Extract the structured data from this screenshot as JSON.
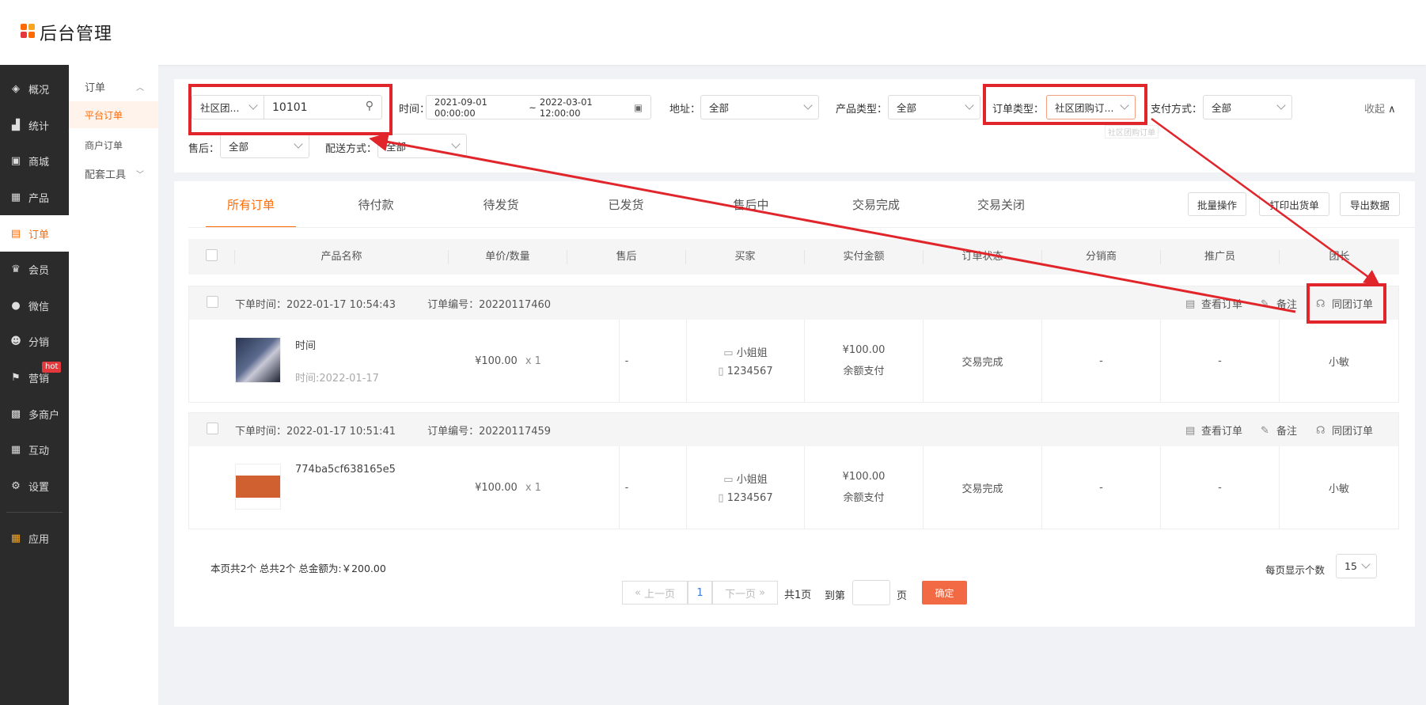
{
  "app": {
    "title": "后台管理"
  },
  "sidebar": {
    "items": [
      {
        "label": "概况",
        "icon": "layers-icon"
      },
      {
        "label": "统计",
        "icon": "chart-icon"
      },
      {
        "label": "商城",
        "icon": "store-icon"
      },
      {
        "label": "产品",
        "icon": "grid-icon"
      },
      {
        "label": "订单",
        "icon": "clipboard-icon"
      },
      {
        "label": "会员",
        "icon": "crown-icon"
      },
      {
        "label": "微信",
        "icon": "wechat-icon"
      },
      {
        "label": "分销",
        "icon": "users-icon"
      },
      {
        "label": "营销",
        "icon": "flag-icon"
      },
      {
        "label": "多商户",
        "icon": "shop-icon"
      },
      {
        "label": "互动",
        "icon": "apps-icon"
      },
      {
        "label": "设置",
        "icon": "gear-icon"
      },
      {
        "label": "应用",
        "icon": "colorful-apps-icon"
      }
    ],
    "hot_badge": "hot",
    "accent": "#ff6a00"
  },
  "subnav": {
    "group": "订单",
    "items": [
      "平台订单",
      "商户订单"
    ],
    "tools": "配套工具"
  },
  "filters": {
    "search_type": "社区团...",
    "search_value": "10101",
    "time_label": "时间：",
    "time_start": "2021-09-01 00:00:00",
    "time_sep": "~",
    "time_end": "2022-03-01 12:00:00",
    "address_label": "地址：",
    "address_value": "全部",
    "product_type_label": "产品类型：",
    "product_type_value": "全部",
    "order_type_label": "订单类型：",
    "order_type_value": "社区团购订...",
    "order_type_tooltip": "社区团购订单",
    "pay_label": "支付方式：",
    "pay_value": "全部",
    "collapse": "收起",
    "after_sale_label": "售后：",
    "after_sale_value": "全部",
    "delivery_label": "配送方式：",
    "delivery_value": "全部"
  },
  "tabs": [
    "所有订单",
    "待付款",
    "待发货",
    "已发货",
    "售后中",
    "交易完成",
    "交易关闭"
  ],
  "actions": [
    "批量操作",
    "打印出货单",
    "导出数据"
  ],
  "table": {
    "headers": [
      "产品名称",
      "单价/数量",
      "售后",
      "买家",
      "实付金额",
      "订单状态",
      "分销商",
      "推广员",
      "团长"
    ]
  },
  "orders": [
    {
      "time": "下单时间：2022-01-17 10:54:43",
      "no": "订单编号：20220117460",
      "product": "时间",
      "product_sub": "时间:2022-01-17",
      "price": "¥100.00",
      "qty": "x 1",
      "after_sale": "-",
      "buyer": "小姐姐",
      "phone": "1234567",
      "amount": "¥100.00",
      "pay": "余额支付",
      "status": "交易完成",
      "distributor": "-",
      "promoter": "-",
      "leader": "小敏",
      "act_view": "查看订单",
      "act_note": "备注",
      "act_group": "同团订单"
    },
    {
      "time": "下单时间：2022-01-17 10:51:41",
      "no": "订单编号：20220117459",
      "product": "774ba5cf638165e5",
      "product_sub": "",
      "price": "¥100.00",
      "qty": "x 1",
      "after_sale": "-",
      "buyer": "小姐姐",
      "phone": "1234567",
      "amount": "¥100.00",
      "pay": "余额支付",
      "status": "交易完成",
      "distributor": "-",
      "promoter": "-",
      "leader": "小敏",
      "act_view": "查看订单",
      "act_note": "备注",
      "act_group": "同团订单"
    }
  ],
  "footer": {
    "summary": "本页共2个   总共2个   总金额为:￥200.00",
    "page_size_label": "每页显示个数",
    "page_size": "15",
    "prev": "上一页",
    "page": "1",
    "next": "下一页",
    "total_pages": "共1页",
    "goto": "到第",
    "page_unit": "页",
    "confirm": "确定"
  },
  "colors": {
    "highlight": "#e0252b",
    "accent": "#ff6a00",
    "sidebar_bg": "#2b2b2b"
  }
}
